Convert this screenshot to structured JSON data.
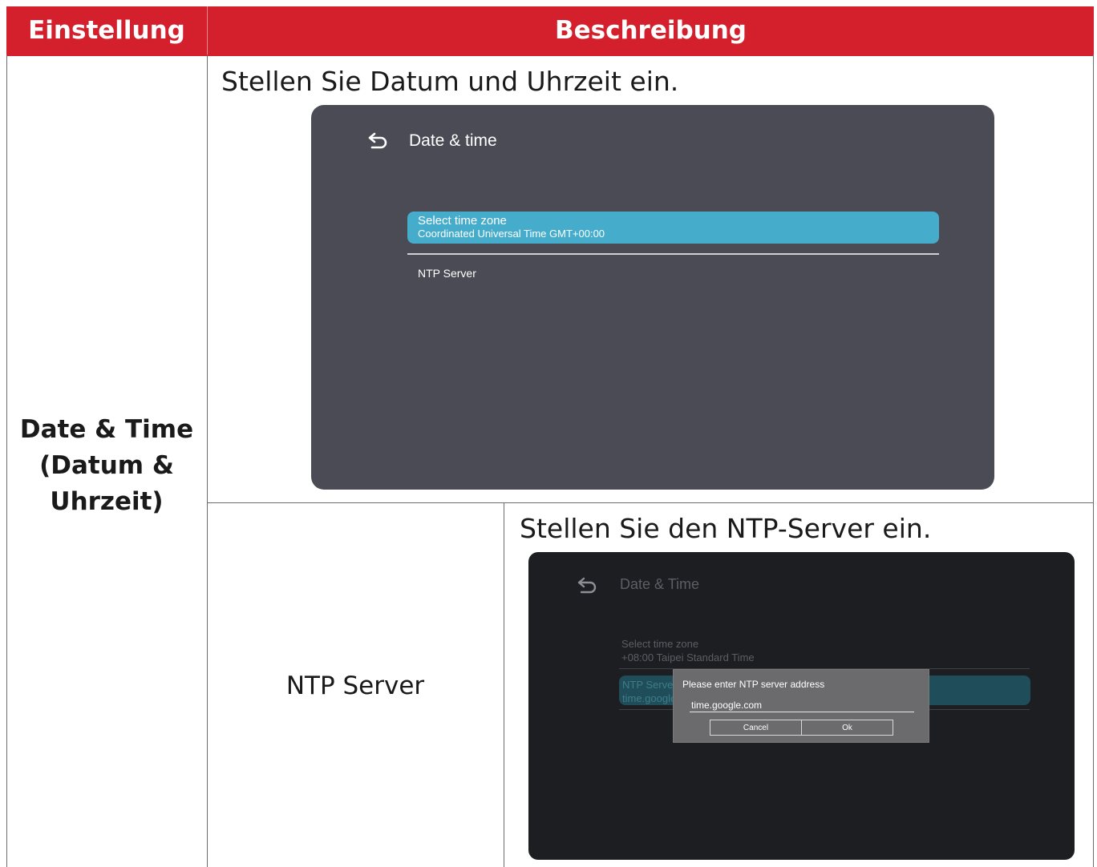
{
  "table": {
    "header_setting": "Einstellung",
    "header_description": "Beschreibung",
    "setting_name": "Date & Time (Datum & Uhrzeit)",
    "description": "Stellen Sie Datum und Uhrzeit ein.",
    "sub_setting_name": "NTP Server",
    "sub_description": "Stellen Sie den NTP-Server ein.",
    "colors": {
      "header_bg": "#d41f2c",
      "header_text": "#ffffff"
    }
  },
  "screen_date_time": {
    "back_icon": "back-arrow-icon",
    "title": "Date & time",
    "timezone_label": "Select time zone",
    "timezone_value": "Coordinated Universal Time GMT+00:00",
    "ntp_label": "NTP Server",
    "colors": {
      "background": "#4b4b55",
      "highlight": "#45adcb"
    }
  },
  "screen_ntp": {
    "back_icon": "back-arrow-icon",
    "title": "Date & Time",
    "timezone_label": "Select time zone",
    "timezone_value": "+08:00 Taipei Standard Time",
    "ntp_label": "NTP Server",
    "ntp_value": "time.google.com",
    "dialog": {
      "prompt": "Please enter NTP server address",
      "input_value": "time.google.com",
      "cancel_label": "Cancel",
      "ok_label": "Ok"
    }
  }
}
